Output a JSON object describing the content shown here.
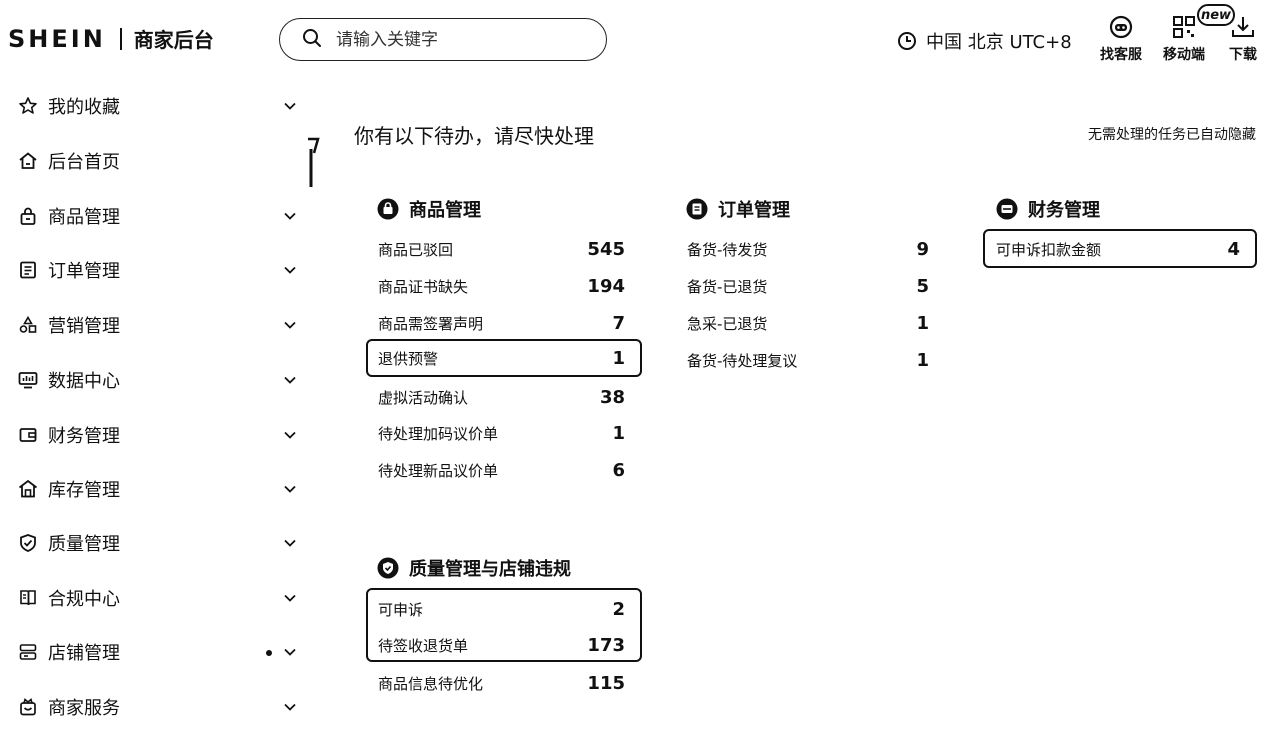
{
  "header": {
    "brand": "SHEIN",
    "subtitle": "商家后台",
    "search_placeholder": "请输入关键字",
    "timezone": "中国 北京 UTC+8",
    "customer_service": "找客服",
    "mobile": "移动端",
    "mobile_badge": "new",
    "download": "下载"
  },
  "sidebar": {
    "items": [
      {
        "label": "我的收藏",
        "icon": "star-icon"
      },
      {
        "label": "后台首页",
        "icon": "home-icon"
      },
      {
        "label": "商品管理",
        "icon": "bag-icon"
      },
      {
        "label": "订单管理",
        "icon": "order-icon"
      },
      {
        "label": "营销管理",
        "icon": "shapes-icon"
      },
      {
        "label": "数据中心",
        "icon": "monitor-icon"
      },
      {
        "label": "财务管理",
        "icon": "wallet-icon"
      },
      {
        "label": "库存管理",
        "icon": "warehouse-icon"
      },
      {
        "label": "质量管理",
        "icon": "shield-icon"
      },
      {
        "label": "合规中心",
        "icon": "book-icon"
      },
      {
        "label": "店铺管理",
        "icon": "store-icon"
      },
      {
        "label": "商家服务",
        "icon": "service-icon"
      }
    ]
  },
  "main": {
    "title": "你有以下待办，请尽快处理",
    "auto_hide_note": "无需处理的任务已自动隐藏"
  },
  "sections": {
    "product": {
      "title": "商品管理",
      "rows": [
        {
          "label": "商品已驳回",
          "count": "545"
        },
        {
          "label": "商品证书缺失",
          "count": "194"
        },
        {
          "label": "商品需签署声明",
          "count": "7"
        },
        {
          "label": "退供预警",
          "count": "1"
        },
        {
          "label": "虚拟活动确认",
          "count": "38"
        },
        {
          "label": "待处理加码议价单",
          "count": "1"
        },
        {
          "label": "待处理新品议价单",
          "count": "6"
        }
      ]
    },
    "order": {
      "title": "订单管理",
      "rows": [
        {
          "label": "备货-待发货",
          "count": "9"
        },
        {
          "label": "备货-已退货",
          "count": "5"
        },
        {
          "label": "急采-已退货",
          "count": "1"
        },
        {
          "label": "备货-待处理复议",
          "count": "1"
        }
      ]
    },
    "finance": {
      "title": "财务管理",
      "rows": [
        {
          "label": "可申诉扣款金额",
          "count": "4"
        }
      ]
    },
    "quality": {
      "title": "质量管理与店铺违规",
      "rows": [
        {
          "label": "可申诉",
          "count": "2"
        },
        {
          "label": "待签收退货单",
          "count": "173"
        },
        {
          "label": "商品信息待优化",
          "count": "115"
        }
      ]
    }
  }
}
